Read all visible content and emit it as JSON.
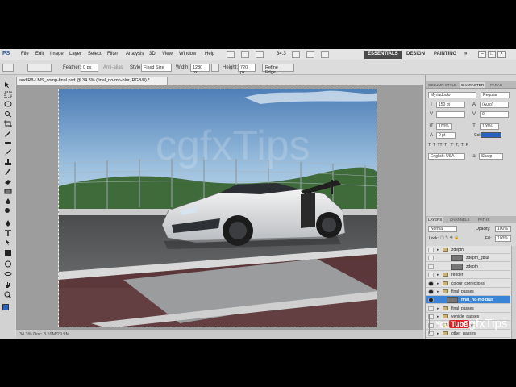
{
  "menubar": {
    "logo": "PS",
    "items": [
      "File",
      "Edit",
      "Image",
      "Layer",
      "Select",
      "Filter",
      "Analysis",
      "3D",
      "View",
      "Window",
      "Help"
    ],
    "zoom": "34.3",
    "workspaces": [
      "ESSENTIALS",
      "DESIGN",
      "PAINTING",
      "»"
    ]
  },
  "options": {
    "feather_label": "Feather:",
    "feather_value": "0 px",
    "antialias_label": "Anti-alias",
    "style_label": "Style:",
    "style_value": "Fixed Size",
    "width_label": "Width:",
    "width_value": "1280 px",
    "height_label": "Height:",
    "height_value": "720 px",
    "refine_edge": "Refine Edge..."
  },
  "document": {
    "tab_title": "audiR8-LMS_comp-final.psd @ 34.3% (final_no-mo-blur, RGB/8) *",
    "status": "34.3%     Doc: 3.59M/29.9M",
    "watermark": "cgfxTips"
  },
  "panels": {
    "char_tabs": [
      "COLUMN STYLE",
      "CHARACTER",
      "PARAG"
    ],
    "font_family": "Myriadpolo",
    "font_style": "Regular",
    "font_size": "150 pt",
    "leading": "(Auto)",
    "tracking": "0",
    "scale_v": "100%",
    "scale_h": "100%",
    "baseline": "0 pt",
    "color_label": "Color:",
    "language": "English: USA",
    "antialias": "Sharp",
    "layer_tabs": [
      "LAYERS",
      "CHANNELS",
      "PATHS"
    ],
    "blend_mode": "Normal",
    "opacity_label": "Opacity:",
    "opacity_value": "100%",
    "lock_label": "Lock:",
    "fill_label": "Fill:",
    "fill_value": "100%",
    "layers": [
      {
        "name": "zdepth",
        "kind": "group",
        "visible": false
      },
      {
        "name": "zdepth_gblur",
        "kind": "image",
        "visible": false
      },
      {
        "name": "zdepth",
        "kind": "image",
        "visible": false
      },
      {
        "name": "render",
        "kind": "group",
        "visible": false
      },
      {
        "name": "colour_corrections",
        "kind": "group",
        "visible": true
      },
      {
        "name": "final_passes",
        "kind": "group",
        "visible": true
      },
      {
        "name": "final_no-mo-blur",
        "kind": "image",
        "visible": true,
        "selected": true
      },
      {
        "name": "final_passes",
        "kind": "group",
        "visible": false
      },
      {
        "name": "vehicle_passes",
        "kind": "group",
        "visible": false
      },
      {
        "name": "track_passes",
        "kind": "group",
        "visible": false
      },
      {
        "name": "other_passes",
        "kind": "group",
        "visible": false
      }
    ]
  },
  "overlay": {
    "youtube_you": "You",
    "youtube_tube": "Tube",
    "brand": "cgfxTips"
  },
  "colors": {
    "accent": "#3a84d8",
    "swatch": "#2a62c4",
    "app_bg": "#d8d8d8",
    "youtube_red": "#dd2222"
  }
}
